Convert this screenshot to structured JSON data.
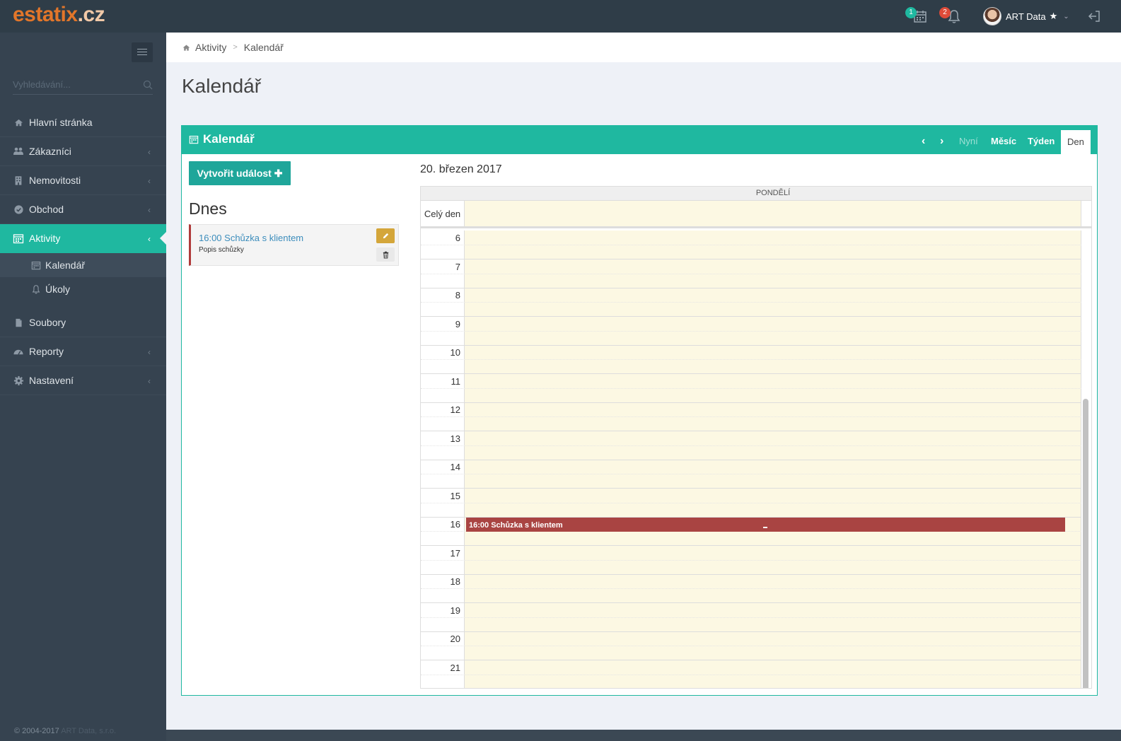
{
  "app": {
    "logo_main": "estatix",
    "logo_tld": ".cz"
  },
  "topbar": {
    "calendar_badge": "1",
    "calendar_badge_color": "#1fb8a0",
    "bell_badge": "2",
    "bell_badge_color": "#dd4b39",
    "user_name": "ART Data",
    "user_star": "★"
  },
  "sidebar": {
    "search_placeholder": "Vyhledávání...",
    "items": [
      {
        "label": "Hlavní stránka"
      },
      {
        "label": "Zákazníci"
      },
      {
        "label": "Nemovitosti"
      },
      {
        "label": "Obchod"
      },
      {
        "label": "Aktivity"
      },
      {
        "label": "Soubory"
      },
      {
        "label": "Reporty"
      },
      {
        "label": "Nastavení"
      }
    ],
    "sub_items": [
      {
        "label": "Kalendář"
      },
      {
        "label": "Úkoly"
      }
    ],
    "copyright": "© 2004-2017",
    "copyright_owner": "ART Data, s.r.o."
  },
  "breadcrumb": {
    "parent": "Aktivity",
    "current": "Kalendář"
  },
  "page": {
    "title": "Kalendář"
  },
  "calendar_box": {
    "title": "Kalendář",
    "nav_now": "Nyní",
    "view_month": "Měsíc",
    "view_week": "Týden",
    "view_day": "Den",
    "create_button": "Vytvořit událost ✚",
    "today_title": "Dnes",
    "today_event": {
      "title": "16:00 Schůzka s klientem",
      "description": "Popis schůzky"
    },
    "date_title": "20. březen 2017",
    "day_header": "PONDĚLÍ",
    "all_day_label": "Celý den",
    "hours": [
      "6",
      "7",
      "8",
      "9",
      "10",
      "11",
      "12",
      "13",
      "14",
      "15",
      "16",
      "17",
      "18",
      "19",
      "20",
      "21"
    ],
    "event": {
      "label": "16:00 Schůzka s klientem",
      "color": "#a94442"
    }
  },
  "colors": {
    "accent": "#1fb8a0",
    "sidebar_bg": "#364350",
    "topbar_bg": "#2f3d48",
    "logo": "#e2762a"
  }
}
